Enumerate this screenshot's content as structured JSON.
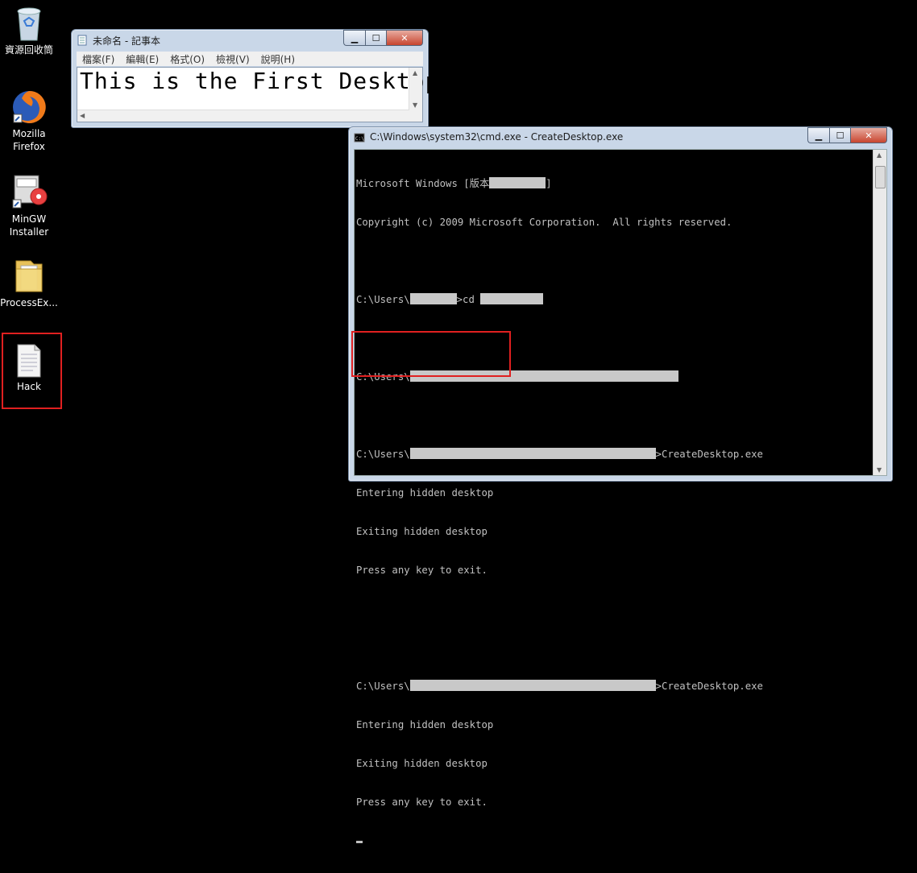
{
  "desktop": {
    "icons": [
      {
        "label": "資源回收筒",
        "icon": "recycle-bin-icon"
      },
      {
        "label": "Mozilla Firefox",
        "icon": "firefox-icon"
      },
      {
        "label": "MinGW Installer",
        "icon": "installer-icon"
      },
      {
        "label": "ProcessEx...",
        "icon": "folder-icon"
      },
      {
        "label": "Hack",
        "icon": "text-file-icon"
      }
    ]
  },
  "notepad": {
    "title": "未命名 - 記事本",
    "menu": [
      "檔案(F)",
      "編輯(E)",
      "格式(O)",
      "檢視(V)",
      "說明(H)"
    ],
    "content": "This is the First Desktop"
  },
  "cmd": {
    "title": "C:\\Windows\\system32\\cmd.exe - CreateDesktop.exe",
    "lines": {
      "l1": "Microsoft Windows [版本",
      "l1_end": "]",
      "l2": "Copyright (c) 2009 Microsoft Corporation.  All rights reserved.",
      "l3_prompt": "C:\\Users\\",
      "l3_cmd": ">cd",
      "l4_prompt": "C:\\Users\\",
      "l5_prompt": "C:\\Users\\",
      "l5_cmd": ">CreateDesktop.exe",
      "l6": "Entering hidden desktop",
      "l7": "Exiting hidden desktop",
      "l8": "Press any key to exit.",
      "l9_prompt": "C:\\Users\\",
      "l9_cmd": ">CreateDesktop.exe",
      "l10": "Entering hidden desktop",
      "l11": "Exiting hidden desktop",
      "l12": "Press any key to exit."
    }
  },
  "colors": {
    "highlight": "#e02020",
    "console_text": "#c0c0c0",
    "redaction": "#c8c8c8"
  }
}
